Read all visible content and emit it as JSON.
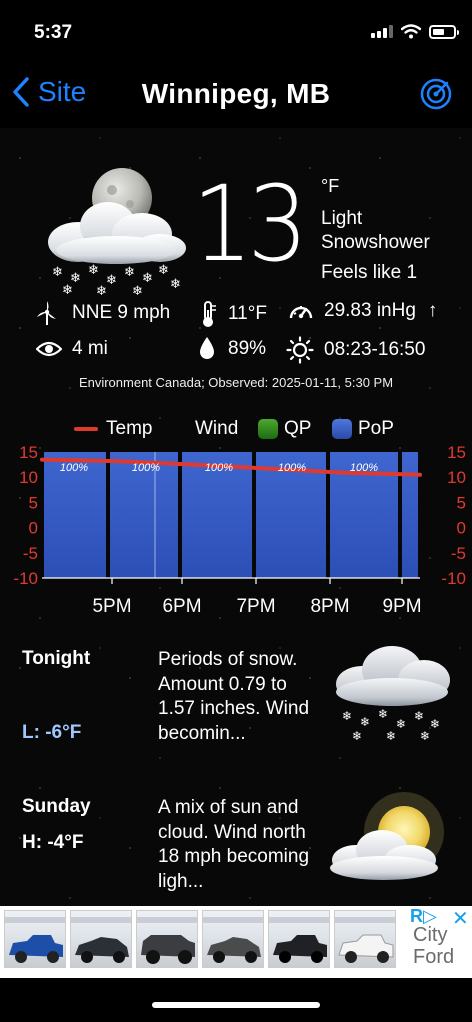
{
  "status_bar": {
    "time": "5:37"
  },
  "nav": {
    "back_label": "Site",
    "title": "Winnipeg, MB"
  },
  "current": {
    "temperature": "13",
    "unit": "°F",
    "condition_line1": "Light",
    "condition_line2": "Snowshower",
    "feels_like": "Feels like 1",
    "wind": "NNE 9 mph",
    "dew_point": "11°F",
    "pressure": "29.83 inHg",
    "pressure_trend": "↑",
    "visibility": "4 mi",
    "humidity": "89%",
    "sun_times": "08:23-16:50",
    "observed": "Environment Canada; Observed: 2025-01-11, 5:30 PM",
    "icons": {
      "main": "moon-cloud-snow-icon",
      "wind": "wind-turbine-icon",
      "dew": "thermometer-icon",
      "pressure": "gauge-icon",
      "visibility": "eye-icon",
      "humidity": "droplet-icon",
      "sun": "sun-icon"
    }
  },
  "legend": {
    "temp": "Temp",
    "wind": "Wind",
    "qp": "QP",
    "pop": "PoP"
  },
  "colors": {
    "accent": "#1e82ff",
    "temp_line": "#e03a2f",
    "pop_bar": "#3b5fc8",
    "qp": "#2e8b1e",
    "axis_labels": "#e03a2f"
  },
  "chart_data": {
    "type": "bar",
    "y_ticks": [
      "15",
      "10",
      "5",
      "0",
      "-5",
      "-10"
    ],
    "ylim": [
      -10,
      15
    ],
    "x_ticks": [
      "5PM",
      "6PM",
      "7PM",
      "8PM",
      "9PM"
    ],
    "pop_labels": [
      "100%",
      "100%",
      "100%",
      "100%",
      "100%"
    ],
    "series": [
      {
        "name": "PoP",
        "values": [
          100,
          100,
          100,
          100,
          100
        ],
        "unit": "%"
      },
      {
        "name": "Temp",
        "values": [
          13.5,
          13.2,
          12.5,
          11.7,
          10.9,
          10.5
        ],
        "unit": "°F"
      }
    ]
  },
  "forecast": [
    {
      "period": "Tonight",
      "temp_label": "L: -6°F",
      "text": "Periods of snow. Amount 0.79 to 1.57 inches. Wind becomin...",
      "icon": "cloud-snow-icon",
      "temp_color": "#9fc8ff"
    },
    {
      "period": "Sunday",
      "temp_label": "H: -4°F",
      "text": "A mix of sun and cloud. Wind north 18 mph becoming ligh...",
      "icon": "sun-cloud-icon",
      "temp_color": "#ffffff"
    }
  ],
  "ad": {
    "brand_line1": "City",
    "brand_line2": "Ford",
    "adchoices": "R▷",
    "close": "✕"
  }
}
